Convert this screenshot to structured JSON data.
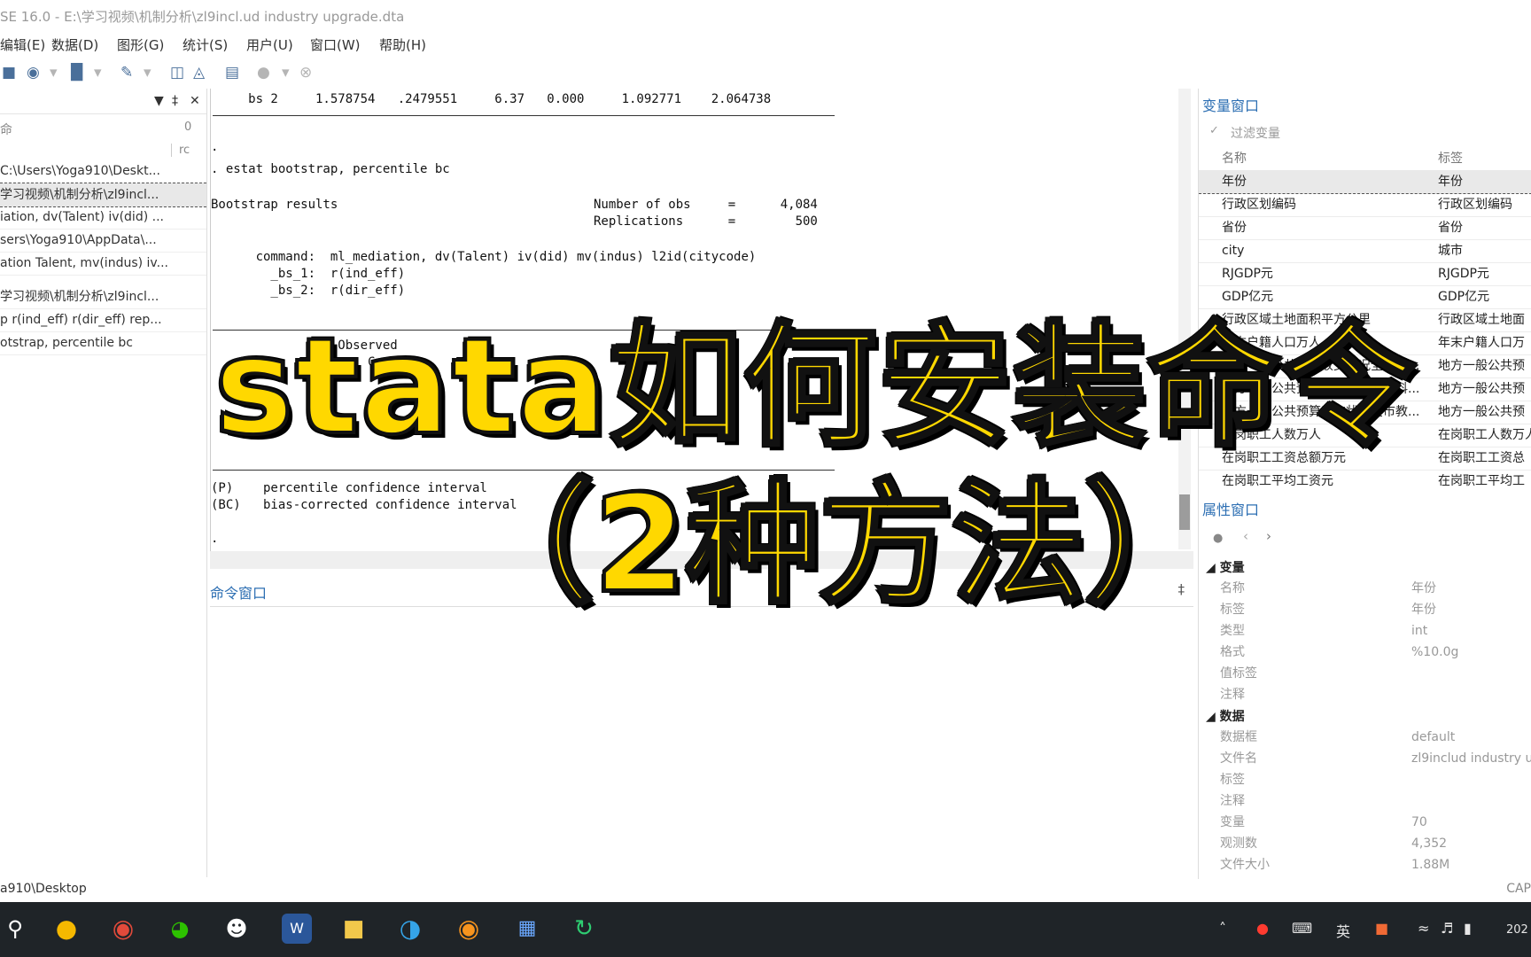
{
  "window": {
    "title": "SE 16.0 - E:\\学习视频\\机制分析\\zl9incl.ud industry upgrade.dta"
  },
  "menu": [
    "编辑(E)",
    "数据(D)",
    "图形(G)",
    "统计(S)",
    "用户(U)",
    "窗口(W)",
    "帮助(H)"
  ],
  "history": {
    "header_icons": [
      "filter-icon",
      "pin-icon",
      "close-icon"
    ],
    "search_col": "命",
    "rc_label": "rc",
    "items": [
      "C:\\Users\\Yoga910\\Deskt...",
      "学习视频\\机制分析\\zl9incl...",
      "iation, dv(Talent) iv(did) ...",
      "sers\\Yoga910\\AppData\\...",
      "ation Talent, mv(indus) iv...",
      "学习视频\\机制分析\\zl9incl...",
      "p r(ind_eff) r(dir_eff) rep...",
      "otstrap, percentile bc"
    ]
  },
  "results": {
    "top_row": "     bs 2     1.578754   .2479551     6.37   0.000     1.092771    2.064738",
    "cmd_dot": ".",
    "cmd": ". estat bootstrap, percentile bc",
    "boot_title": "Bootstrap results",
    "nobs_label": "Number of obs     =      4,084",
    "reps_label": "Replications      =        500",
    "command_line": "      command:  ml_mediation, dv(Talent) iv(did) mv(indus) l2id(citycode)",
    "bs1_line": "        _bs_1:  r(ind_eff)",
    "bs2_line": "        _bs_2:  r(dir_eff)",
    "observed_hdr": "                 Observed",
    "coef_hdr": "                     Coef.        Bias",
    "p_note": "(P)    percentile confidence interval",
    "bc_note": "(BC)   bias-corrected confidence interval",
    "end_dot": "."
  },
  "command_window": {
    "label": "命令窗口"
  },
  "variables": {
    "title": "变量窗口",
    "filter_placeholder": "过滤变量",
    "col_name": "名称",
    "col_label": "标签",
    "rows": [
      {
        "name": "年份",
        "label": "年份"
      },
      {
        "name": "行政区划编码",
        "label": "行政区划编码"
      },
      {
        "name": "省份",
        "label": "省份"
      },
      {
        "name": "city",
        "label": "城市"
      },
      {
        "name": "RJGDP元",
        "label": "RJGDP元"
      },
      {
        "name": "GDP亿元",
        "label": "GDP亿元"
      },
      {
        "name": "行政区域土地面积平方公里",
        "label": "行政区域土地面"
      },
      {
        "name": "年末户籍人口万人",
        "label": "年末户籍人口万"
      },
      {
        "name": "地方一般公共预算收支状况全市公...",
        "label": "地方一般公共预"
      },
      {
        "name": "地方一般公共预算收支状况全市科...",
        "label": "地方一般公共预"
      },
      {
        "name": "地方一般公共预算收支状况全市教...",
        "label": "地方一般公共预"
      },
      {
        "name": "在岗职工人数万人",
        "label": "在岗职工人数万人"
      },
      {
        "name": "在岗职工工资总额万元",
        "label": "在岗职工工资总"
      },
      {
        "name": "在岗职工平均工资元",
        "label": "在岗职工平均工"
      }
    ]
  },
  "properties": {
    "title": "属性窗口",
    "sec_var": "变量",
    "var_rows": [
      {
        "k": "名称",
        "v": "年份"
      },
      {
        "k": "标签",
        "v": "年份"
      },
      {
        "k": "类型",
        "v": "int"
      },
      {
        "k": "格式",
        "v": "%10.0g"
      },
      {
        "k": "值标签",
        "v": ""
      },
      {
        "k": "注释",
        "v": ""
      }
    ],
    "sec_data": "数据",
    "data_rows": [
      {
        "k": "数据框",
        "v": "default"
      },
      {
        "k": "文件名",
        "v": "zl9includ industry u"
      },
      {
        "k": "标签",
        "v": ""
      },
      {
        "k": "注释",
        "v": ""
      },
      {
        "k": "变量",
        "v": "70"
      },
      {
        "k": "观测数",
        "v": "4,352"
      },
      {
        "k": "文件大小",
        "v": "1.88M"
      }
    ]
  },
  "status": {
    "path": "a910\\Desktop",
    "caps": "CAP"
  },
  "taskbar": {
    "ime": "英",
    "clock": "202"
  },
  "overlay": {
    "line1": "stata如何安装命令",
    "line2": "（2种方法）"
  }
}
